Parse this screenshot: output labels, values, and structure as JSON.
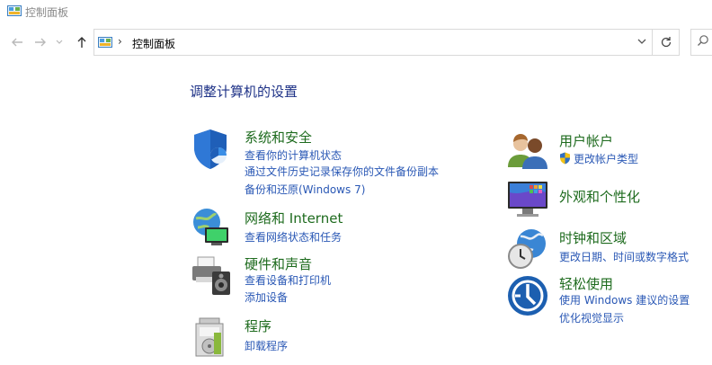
{
  "window": {
    "title": "控制面板"
  },
  "address": {
    "crumb": "控制面板",
    "separator": "›"
  },
  "heading": "调整计算机的设置",
  "left": [
    {
      "key": "security",
      "name": "系统和安全",
      "links": [
        "查看你的计算机状态",
        "通过文件历史记录保存你的文件备份副本",
        "备份和还原(Windows 7)"
      ]
    },
    {
      "key": "network",
      "name": "网络和 Internet",
      "links": [
        "查看网络状态和任务"
      ]
    },
    {
      "key": "hardware",
      "name": "硬件和声音",
      "links": [
        "查看设备和打印机",
        "添加设备"
      ]
    },
    {
      "key": "programs",
      "name": "程序",
      "links": [
        "卸载程序"
      ]
    }
  ],
  "right": [
    {
      "key": "accounts",
      "name": "用户帐户",
      "links": [
        "更改帐户类型"
      ]
    },
    {
      "key": "appearance",
      "name": "外观和个性化",
      "links": []
    },
    {
      "key": "clock",
      "name": "时钟和区域",
      "links": [
        "更改日期、时间或数字格式"
      ]
    },
    {
      "key": "ease",
      "name": "轻松使用",
      "links": [
        "使用 Windows 建议的设置",
        "优化视觉显示"
      ]
    }
  ]
}
